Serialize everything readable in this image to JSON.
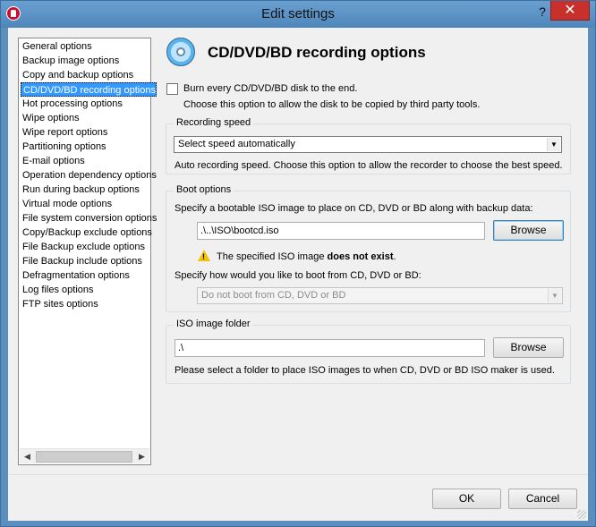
{
  "window": {
    "title": "Edit settings",
    "help_glyph": "?",
    "close_glyph": "✕"
  },
  "nav": {
    "items": [
      {
        "label": "General options",
        "selected": false
      },
      {
        "label": "Backup image options",
        "selected": false
      },
      {
        "label": "Copy and backup options",
        "selected": false
      },
      {
        "label": "CD/DVD/BD recording options",
        "selected": true
      },
      {
        "label": "Hot processing options",
        "selected": false
      },
      {
        "label": "Wipe options",
        "selected": false
      },
      {
        "label": "Wipe report options",
        "selected": false
      },
      {
        "label": "Partitioning options",
        "selected": false
      },
      {
        "label": "E-mail options",
        "selected": false
      },
      {
        "label": "Operation dependency options",
        "selected": false
      },
      {
        "label": "Run during backup options",
        "selected": false
      },
      {
        "label": "Virtual mode options",
        "selected": false
      },
      {
        "label": "File system conversion options",
        "selected": false
      },
      {
        "label": "Copy/Backup exclude options",
        "selected": false
      },
      {
        "label": "File Backup exclude options",
        "selected": false
      },
      {
        "label": "File Backup include options",
        "selected": false
      },
      {
        "label": "Defragmentation options",
        "selected": false
      },
      {
        "label": "Log files options",
        "selected": false
      },
      {
        "label": "FTP sites options",
        "selected": false
      }
    ],
    "scroll_left": "◀",
    "scroll_right": "▶"
  },
  "panel": {
    "title": "CD/DVD/BD recording options",
    "burn_end": {
      "label": "Burn every CD/DVD/BD disk to the end.",
      "checked": false,
      "description": "Choose this option to allow the disk to be copied by third party tools."
    },
    "recording_speed": {
      "group_label": "Recording speed",
      "selected": "Select speed automatically",
      "description": "Auto recording speed. Choose this option to allow the recorder to choose the best speed."
    },
    "boot_options": {
      "group_label": "Boot options",
      "prompt": "Specify a bootable ISO image to place on CD, DVD or BD along with backup data:",
      "iso_path": ".\\..\\ISO\\bootcd.iso",
      "browse_label": "Browse",
      "warning_prefix": "The specified ISO image",
      "warning_bold": "does not exist",
      "warning_suffix": ".",
      "boot_prompt": "Specify how would you like to boot from CD, DVD or BD:",
      "boot_selected": "Do not boot from CD, DVD or BD"
    },
    "iso_folder": {
      "group_label": "ISO image folder",
      "path": ".\\",
      "browse_label": "Browse",
      "description": "Please select a folder to place ISO images to when CD, DVD or BD ISO maker is used."
    }
  },
  "footer": {
    "ok_label": "OK",
    "cancel_label": "Cancel"
  },
  "icons": {
    "app": "app-logo-icon",
    "section": "disc-icon",
    "warning": "warning-icon",
    "dropdown": "chevron-down-icon"
  }
}
